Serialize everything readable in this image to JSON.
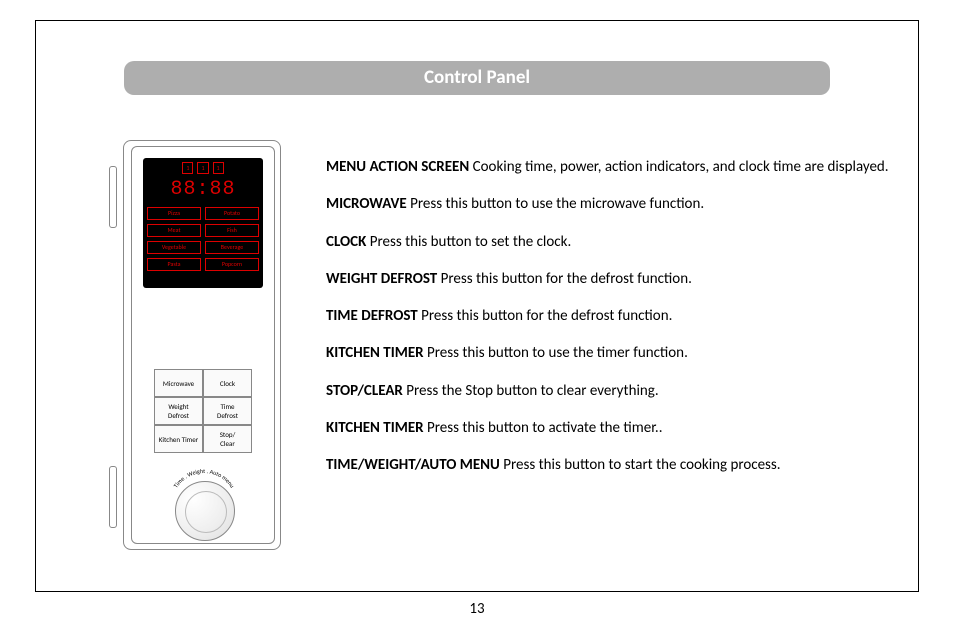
{
  "header": {
    "title": "Control Panel"
  },
  "page_number": "13",
  "illustration": {
    "display": {
      "top_indicators": [
        "1",
        "1",
        "1"
      ],
      "time_digits": "88:88",
      "menu_rows": [
        [
          "Pizza",
          "Potato"
        ],
        [
          "Meat",
          "Fish"
        ],
        [
          "Vegetable",
          "Beverage"
        ],
        [
          "Pasta",
          "Popcorn"
        ]
      ]
    },
    "buttons": [
      "Microwave",
      "Clock",
      "Weight\nDefrost",
      "Time\nDefrost",
      "Kitchen Timer",
      "Stop/\nClear"
    ],
    "dial_label": "Time . Weight . Auto menu"
  },
  "descriptions": [
    {
      "term": "MENU ACTION SCREEN",
      "text": " Cooking time, power, action indicators, and clock time are displayed."
    },
    {
      "term": "MICROWAVE",
      "text": "  Press this button to use the microwave function."
    },
    {
      "term": "CLOCK",
      "text": " Press this button to set the clock."
    },
    {
      "term": "WEIGHT DEFROST",
      "text": " Press this button for the defrost function."
    },
    {
      "term": "TIME DEFROST",
      "text": " Press this button for the defrost function."
    },
    {
      "term": "KITCHEN TIMER",
      "text": " Press this button to use the timer function."
    },
    {
      "term": "STOP/CLEAR",
      "text": " Press the Stop button to clear everything."
    },
    {
      "term": "KITCHEN TIMER",
      "text": " Press this button to activate the timer.."
    },
    {
      "term": "TIME/WEIGHT/AUTO MENU",
      "text": " Press this button to start the cooking process."
    }
  ]
}
